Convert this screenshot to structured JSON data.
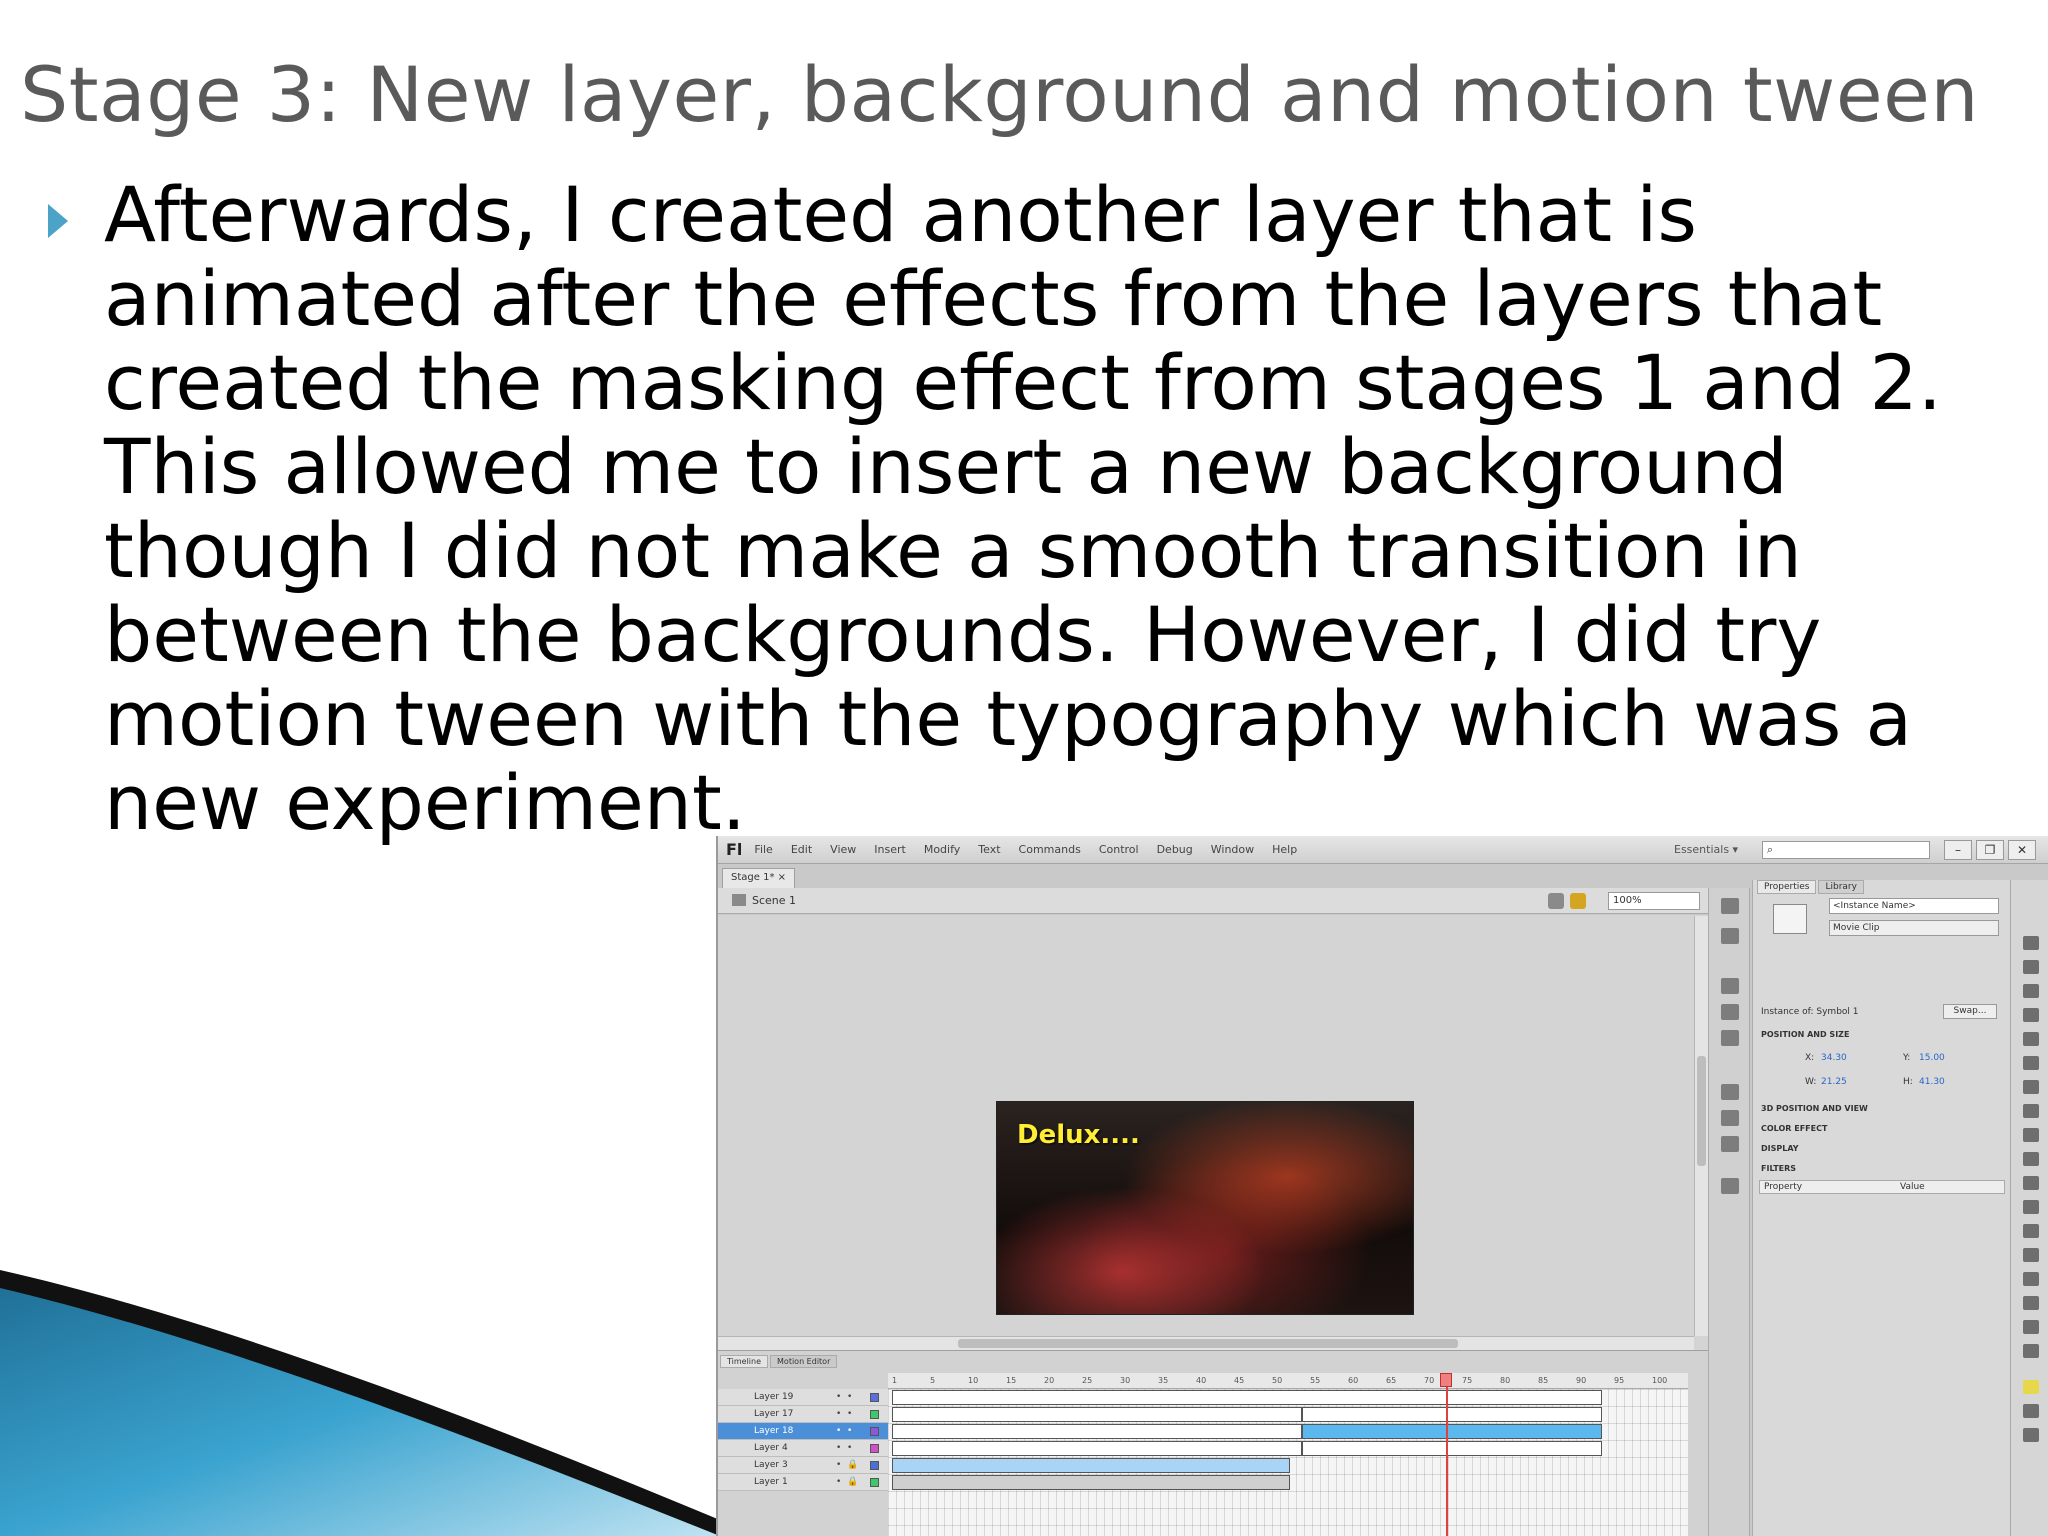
{
  "slide": {
    "title": "Stage 3: New layer, background and motion tween",
    "body": "Afterwards, I created another layer that is animated after the effects from the layers that created the masking effect from stages 1 and 2. This allowed me to insert a new background though I did not make a smooth transition in between the backgrounds. However, I did try motion tween with the typography which was a new experiment.",
    "accent_color": "#4ba3c7"
  },
  "screenshot": {
    "app_logo": "Fl",
    "menu": [
      "File",
      "Edit",
      "View",
      "Insert",
      "Modify",
      "Text",
      "Commands",
      "Control",
      "Debug",
      "Window",
      "Help"
    ],
    "workspace": "Essentials ▾",
    "window_buttons": [
      "–",
      "❐",
      "✕"
    ],
    "doc_tab": "Stage 1* ×",
    "scene": "Scene 1",
    "zoom": "100%",
    "stage_text": "Delux....",
    "properties": {
      "tabs": [
        "Properties",
        "Library"
      ],
      "instance_name": "<Instance Name>",
      "instance_type": "Movie Clip",
      "instance_of": "Instance of: Symbol 1",
      "swap": "Swap...",
      "position_size": "POSITION AND SIZE",
      "x_label": "X:",
      "x_value": "34.30",
      "y_label": "Y:",
      "y_value": "15.00",
      "w_label": "W:",
      "w_value": "21.25",
      "h_label": "H:",
      "h_value": "41.30",
      "sections": [
        "3D POSITION AND VIEW",
        "COLOR EFFECT",
        "DISPLAY",
        "FILTERS"
      ],
      "filter_cols": [
        "Property",
        "Value"
      ]
    },
    "timeline": {
      "tabs": [
        "Timeline",
        "Motion Editor"
      ],
      "frames": [
        "1",
        "5",
        "10",
        "15",
        "20",
        "25",
        "30",
        "35",
        "40",
        "45",
        "50",
        "55",
        "60",
        "65",
        "70",
        "75",
        "80",
        "85",
        "90",
        "95",
        "100"
      ],
      "playhead_frame": 71,
      "layers": [
        {
          "name": "Layer 19",
          "color": "#5a6ee0",
          "selected": false
        },
        {
          "name": "Layer 17",
          "color": "#3ec76b",
          "selected": false
        },
        {
          "name": "Layer 18",
          "color": "#8a58d8",
          "selected": true
        },
        {
          "name": "Layer 4",
          "color": "#d052c8",
          "selected": false
        },
        {
          "name": "Layer 3",
          "color": "#4a6fd8",
          "selected": false
        },
        {
          "name": "Layer 1",
          "color": "#3ec76b",
          "selected": false
        }
      ]
    }
  }
}
